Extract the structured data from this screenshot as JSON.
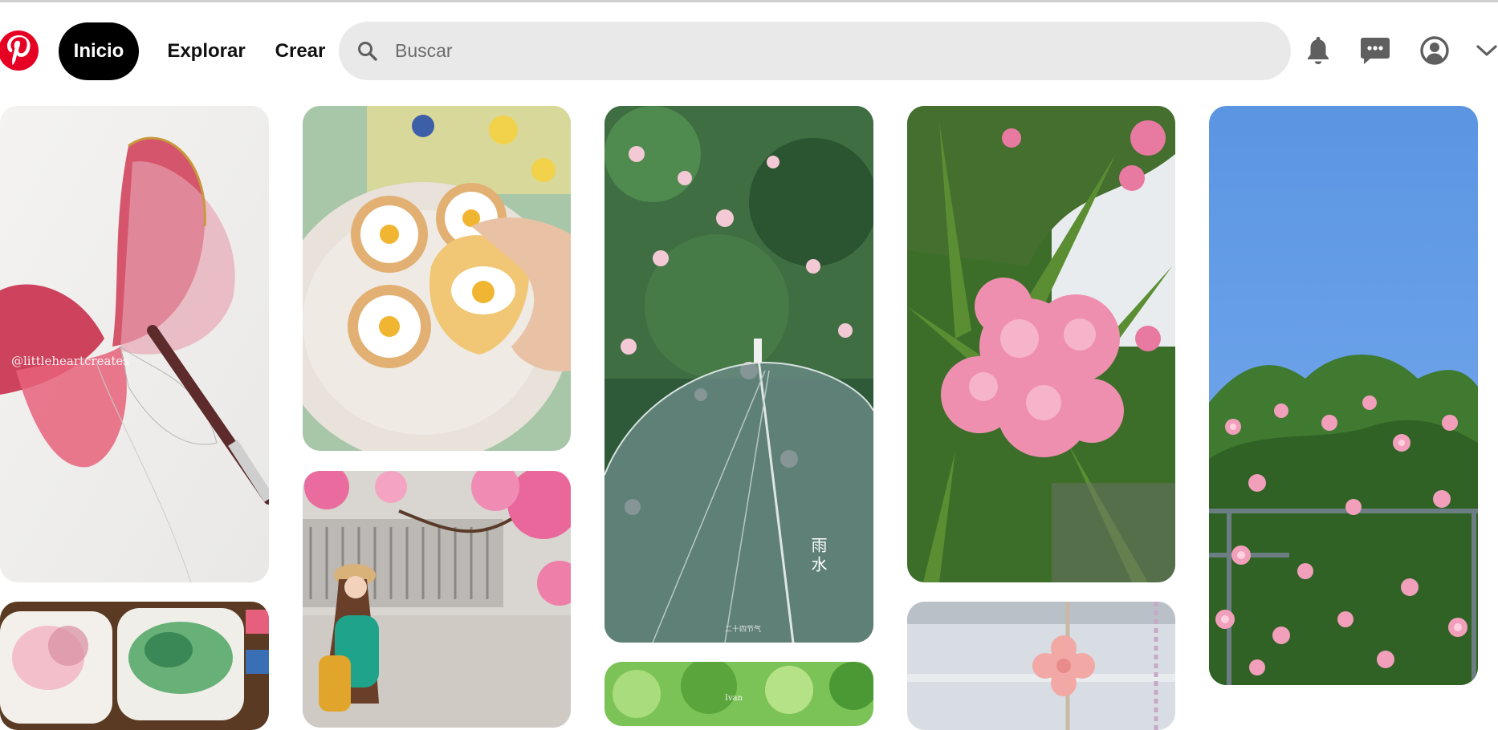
{
  "header": {
    "logo_icon": "pinterest-logo-icon",
    "nav": {
      "home": "Inicio",
      "explore": "Explorar",
      "create": "Crear"
    },
    "search": {
      "placeholder": "Buscar",
      "icon": "search-icon"
    },
    "icons": [
      "bell-icon",
      "chat-icon",
      "user-circle-icon",
      "chevron-down-icon"
    ]
  },
  "pins": [
    {
      "subject": "watercolor butterfly painting",
      "caption": "@littleheartcreates"
    },
    {
      "subject": "daisy cookies on plate",
      "caption": ""
    },
    {
      "subject": "blossoms over clear umbrella",
      "caption": "雨水",
      "caption_small": "二十四节气"
    },
    {
      "subject": "pink oleander flowers",
      "caption": ""
    },
    {
      "subject": "pink climbing roses under blue sky",
      "caption": ""
    },
    {
      "subject": "watercolor palettes",
      "caption": ""
    },
    {
      "subject": "illustrated girl under pink blossoms",
      "caption": ""
    },
    {
      "subject": "green leaves",
      "caption": "Ivan"
    },
    {
      "subject": "crochet flower hanging on window",
      "caption": ""
    }
  ],
  "colors": {
    "brand": "#e60023",
    "search_bg": "#e9e9e9",
    "active_nav": "#000000"
  }
}
